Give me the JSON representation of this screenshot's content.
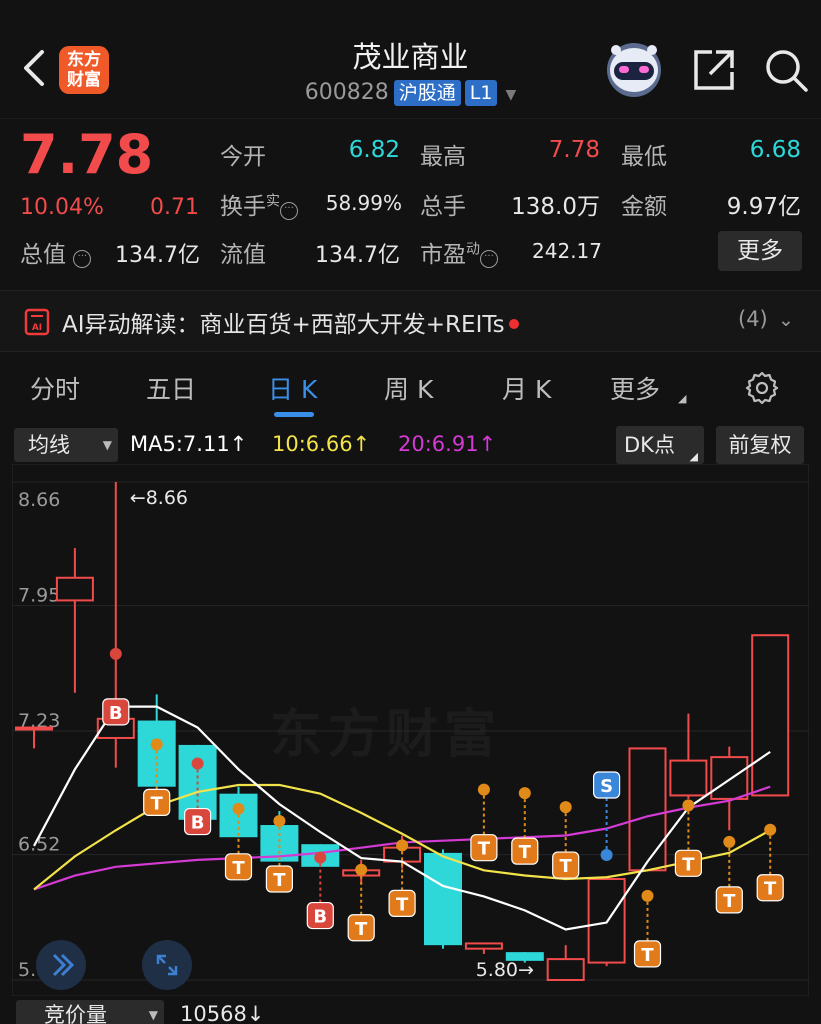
{
  "header": {
    "logo_line1": "东方",
    "logo_line2": "财富",
    "stock_name": "茂业商业",
    "stock_code": "600828",
    "tag_connect": "沪股通",
    "tag_level": "L1"
  },
  "quote": {
    "price": "7.78",
    "change_pct": "10.04%",
    "change_amt": "0.71",
    "fields": {
      "open_label": "今开",
      "open_value": "6.82",
      "high_label": "最高",
      "high_value": "7.78",
      "low_label": "最低",
      "low_value": "6.68",
      "turnover_label": "换手",
      "turnover_sup": "实",
      "turnover_value": "58.99%",
      "volume_label": "总手",
      "volume_value": "138.0万",
      "amount_label": "金额",
      "amount_value": "9.97亿",
      "mktcap_label": "总值",
      "mktcap_value": "134.7亿",
      "float_label": "流值",
      "float_value": "134.7亿",
      "pe_label": "市盈",
      "pe_sup": "动",
      "pe_value": "242.17"
    },
    "more_label": "更多",
    "colors": {
      "up": "#f14b4b",
      "down": "#2ed8d8"
    }
  },
  "ai": {
    "icon_text": "AI",
    "text": "AI异动解读：商业百货+西部大开发+REITs",
    "count": "(4)"
  },
  "tabs": [
    {
      "label": "分时"
    },
    {
      "label": "五日"
    },
    {
      "label": "日 K"
    },
    {
      "label": "周 K"
    },
    {
      "label": "月 K"
    },
    {
      "label": "更多"
    }
  ],
  "ma_row": {
    "select_label": "均线",
    "ma5": "MA5:7.11↑",
    "ma10": "10:6.66↑",
    "ma20": "20:6.91↑",
    "ma5_color": "#ffffff",
    "ma10_color": "#f3e34a",
    "ma20_color": "#d43ad4",
    "dk_label": "DK点",
    "adj_label": "前复权"
  },
  "chart_data": {
    "type": "candlestick",
    "y_ticks": [
      "8.66",
      "7.95",
      "7.23",
      "6.52",
      "5.80"
    ],
    "ylim": [
      5.8,
      8.66
    ],
    "high_marker": "←8.66",
    "low_marker": "5.80→",
    "watermark": "东方财富",
    "candles": [
      {
        "o": 7.25,
        "c": 7.25,
        "h": 7.25,
        "l": 7.13
      },
      {
        "o": 7.98,
        "c": 8.11,
        "h": 8.28,
        "l": 7.45
      },
      {
        "o": 7.19,
        "c": 7.3,
        "h": 8.66,
        "l": 7.02
      },
      {
        "o": 7.29,
        "c": 6.91,
        "h": 7.44,
        "l": 6.91
      },
      {
        "o": 7.15,
        "c": 6.72,
        "h": 7.15,
        "l": 6.72
      },
      {
        "o": 6.87,
        "c": 6.62,
        "h": 6.91,
        "l": 6.62
      },
      {
        "o": 6.69,
        "c": 6.48,
        "h": 6.77,
        "l": 6.48
      },
      {
        "o": 6.58,
        "c": 6.45,
        "h": 6.58,
        "l": 6.45
      },
      {
        "o": 6.4,
        "c": 6.43,
        "h": 6.49,
        "l": 6.35
      },
      {
        "o": 6.48,
        "c": 6.56,
        "h": 6.63,
        "l": 6.44
      },
      {
        "o": 6.53,
        "c": 6.0,
        "h": 6.55,
        "l": 5.98
      },
      {
        "o": 5.98,
        "c": 6.01,
        "h": 6.01,
        "l": 5.95
      },
      {
        "o": 5.96,
        "c": 5.91,
        "h": 5.96,
        "l": 5.9
      },
      {
        "o": 5.8,
        "c": 5.92,
        "h": 6.0,
        "l": 5.8
      },
      {
        "o": 5.9,
        "c": 6.38,
        "h": 6.38,
        "l": 5.88
      },
      {
        "o": 6.43,
        "c": 7.13,
        "h": 7.13,
        "l": 6.43
      },
      {
        "o": 6.86,
        "c": 7.06,
        "h": 7.33,
        "l": 6.84
      },
      {
        "o": 6.84,
        "c": 7.08,
        "h": 7.14,
        "l": 6.66
      },
      {
        "o": 6.86,
        "c": 7.78,
        "h": 7.78,
        "l": 6.86
      }
    ],
    "ma5": [
      6.57,
      7.01,
      7.37,
      7.37,
      7.25,
      7.01,
      6.81,
      6.65,
      6.5,
      6.48,
      6.34,
      6.28,
      6.2,
      6.09,
      6.13,
      6.48,
      6.79,
      6.95,
      7.11
    ],
    "ma10": [
      6.32,
      6.51,
      6.66,
      6.8,
      6.88,
      6.92,
      6.92,
      6.87,
      6.76,
      6.64,
      6.51,
      6.43,
      6.4,
      6.38,
      6.39,
      6.43,
      6.48,
      6.53,
      6.66
    ],
    "ma20": [
      6.32,
      6.4,
      6.45,
      6.47,
      6.49,
      6.5,
      6.51,
      6.53,
      6.56,
      6.59,
      6.6,
      6.61,
      6.62,
      6.63,
      6.67,
      6.74,
      6.79,
      6.83,
      6.91
    ],
    "signals": [
      {
        "i": 2,
        "type": "B",
        "v": 7.34
      },
      {
        "i": 3,
        "type": "T",
        "v": 6.82
      },
      {
        "i": 4,
        "type": "B",
        "v": 6.71
      },
      {
        "i": 5,
        "type": "T",
        "v": 6.45
      },
      {
        "i": 6,
        "type": "T",
        "v": 6.38
      },
      {
        "i": 7,
        "type": "B",
        "v": 6.17
      },
      {
        "i": 8,
        "type": "T",
        "v": 6.1
      },
      {
        "i": 9,
        "type": "T",
        "v": 6.24
      },
      {
        "i": 11,
        "type": "T",
        "v": 6.56
      },
      {
        "i": 12,
        "type": "T",
        "v": 6.54
      },
      {
        "i": 13,
        "type": "T",
        "v": 6.46
      },
      {
        "i": 14,
        "type": "S",
        "v": 6.92
      },
      {
        "i": 15,
        "type": "T",
        "v": 5.95
      },
      {
        "i": 16,
        "type": "T",
        "v": 6.47
      },
      {
        "i": 17,
        "type": "T",
        "v": 6.26
      },
      {
        "i": 18,
        "type": "T",
        "v": 6.33
      }
    ]
  },
  "volume": {
    "select_label": "竞价量",
    "value": "10568↓"
  }
}
